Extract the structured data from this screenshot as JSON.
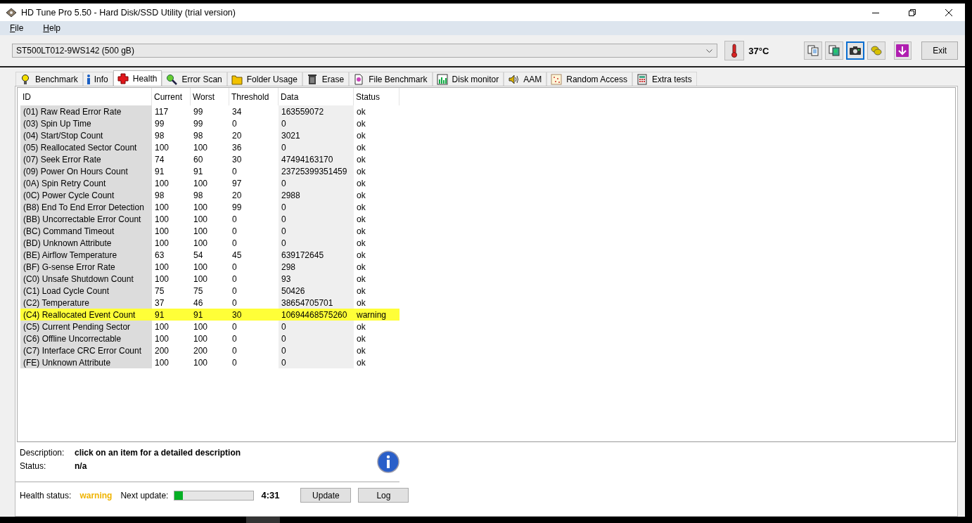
{
  "window": {
    "title": "HD Tune Pro 5.50 - Hard Disk/SSD Utility (trial version)"
  },
  "menu": [
    {
      "label": "File"
    },
    {
      "label": "Help"
    }
  ],
  "toolbar": {
    "drive": "ST500LT012-9WS142 (500 gB)",
    "temperature": "37°C",
    "buttons": [
      {
        "selected": false
      },
      {
        "selected": false
      },
      {
        "selected": true
      },
      {
        "selected": false
      },
      {
        "selected": false
      }
    ],
    "exit": "Exit"
  },
  "tabs": [
    {
      "label": "Benchmark",
      "selected": false
    },
    {
      "label": "Info",
      "selected": false
    },
    {
      "label": "Health",
      "selected": true
    },
    {
      "label": "Error Scan",
      "selected": false
    },
    {
      "label": "Folder Usage",
      "selected": false
    },
    {
      "label": "Erase",
      "selected": false
    },
    {
      "label": "File Benchmark",
      "selected": false
    },
    {
      "label": "Disk monitor",
      "selected": false
    },
    {
      "label": "AAM",
      "selected": false
    },
    {
      "label": "Random Access",
      "selected": false
    },
    {
      "label": "Extra tests",
      "selected": false
    }
  ],
  "table": {
    "columns": [
      "ID",
      "Current",
      "Worst",
      "Threshold",
      "Data",
      "Status"
    ],
    "rows": [
      {
        "cells": [
          "(01) Raw Read Error Rate",
          "117",
          "99",
          "34",
          "163559072",
          "ok"
        ],
        "highlighted": false
      },
      {
        "cells": [
          "(03) Spin Up Time",
          "99",
          "99",
          "0",
          "0",
          "ok"
        ],
        "highlighted": false
      },
      {
        "cells": [
          "(04) Start/Stop Count",
          "98",
          "98",
          "20",
          "3021",
          "ok"
        ],
        "highlighted": false
      },
      {
        "cells": [
          "(05) Reallocated Sector Count",
          "100",
          "100",
          "36",
          "0",
          "ok"
        ],
        "highlighted": false
      },
      {
        "cells": [
          "(07) Seek Error Rate",
          "74",
          "60",
          "30",
          "47494163170",
          "ok"
        ],
        "highlighted": false
      },
      {
        "cells": [
          "(09) Power On Hours Count",
          "91",
          "91",
          "0",
          "23725399351459",
          "ok"
        ],
        "highlighted": false
      },
      {
        "cells": [
          "(0A) Spin Retry Count",
          "100",
          "100",
          "97",
          "0",
          "ok"
        ],
        "highlighted": false
      },
      {
        "cells": [
          "(0C) Power Cycle Count",
          "98",
          "98",
          "20",
          "2988",
          "ok"
        ],
        "highlighted": false
      },
      {
        "cells": [
          "(B8) End To End Error Detection",
          "100",
          "100",
          "99",
          "0",
          "ok"
        ],
        "highlighted": false
      },
      {
        "cells": [
          "(BB) Uncorrectable Error Count",
          "100",
          "100",
          "0",
          "0",
          "ok"
        ],
        "highlighted": false
      },
      {
        "cells": [
          "(BC) Command Timeout",
          "100",
          "100",
          "0",
          "0",
          "ok"
        ],
        "highlighted": false
      },
      {
        "cells": [
          "(BD) Unknown Attribute",
          "100",
          "100",
          "0",
          "0",
          "ok"
        ],
        "highlighted": false
      },
      {
        "cells": [
          "(BE) Airflow Temperature",
          "63",
          "54",
          "45",
          "639172645",
          "ok"
        ],
        "highlighted": false
      },
      {
        "cells": [
          "(BF) G-sense Error Rate",
          "100",
          "100",
          "0",
          "298",
          "ok"
        ],
        "highlighted": false
      },
      {
        "cells": [
          "(C0) Unsafe Shutdown Count",
          "100",
          "100",
          "0",
          "93",
          "ok"
        ],
        "highlighted": false
      },
      {
        "cells": [
          "(C1) Load Cycle Count",
          "75",
          "75",
          "0",
          "50426",
          "ok"
        ],
        "highlighted": false
      },
      {
        "cells": [
          "(C2) Temperature",
          "37",
          "46",
          "0",
          "38654705701",
          "ok"
        ],
        "highlighted": false
      },
      {
        "cells": [
          "(C4) Reallocated Event Count",
          "91",
          "91",
          "30",
          "10694468575260",
          "warning"
        ],
        "highlighted": true
      },
      {
        "cells": [
          "(C5) Current Pending Sector",
          "100",
          "100",
          "0",
          "0",
          "ok"
        ],
        "highlighted": false
      },
      {
        "cells": [
          "(C6) Offline Uncorrectable",
          "100",
          "100",
          "0",
          "0",
          "ok"
        ],
        "highlighted": false
      },
      {
        "cells": [
          "(C7) Interface CRC Error Count",
          "200",
          "200",
          "0",
          "0",
          "ok"
        ],
        "highlighted": false
      },
      {
        "cells": [
          "(FE) Unknown Attribute",
          "100",
          "100",
          "0",
          "0",
          "ok"
        ],
        "highlighted": false
      }
    ]
  },
  "details": {
    "description_label": "Description:",
    "description": "click on an item for a detailed description",
    "status_label": "Status:",
    "status": "n/a"
  },
  "health": {
    "label": "Health status:",
    "status": "warning",
    "next_label": "Next update:",
    "level": 0.1,
    "countdown": "4:31",
    "buttons": [
      "Update",
      "Log"
    ]
  }
}
